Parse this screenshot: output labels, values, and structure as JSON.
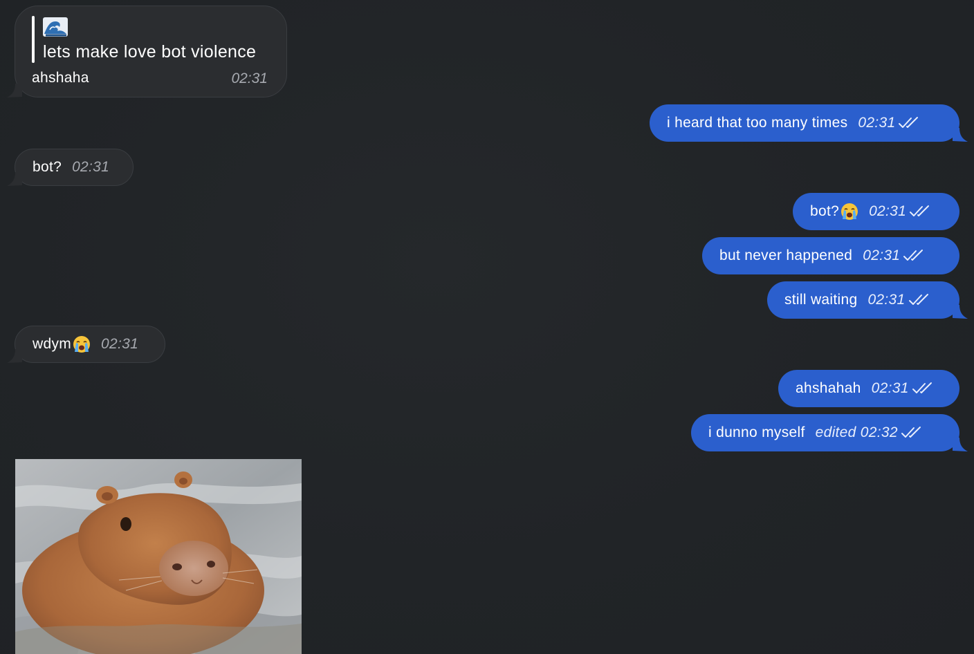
{
  "quote_message": {
    "emoji_icon": "water-wave-icon",
    "text": "lets make love bot violence",
    "sender": "ahshaha",
    "time": "02:31"
  },
  "messages": [
    {
      "text": "i heard that too many times",
      "time": "02:31"
    },
    {
      "text": "bot?",
      "time": "02:31"
    },
    {
      "text": "bot?",
      "time": "02:31",
      "emoji_icon": "loudly-crying-face-icon"
    },
    {
      "text": "but never happened",
      "time": "02:31"
    },
    {
      "text": "still waiting",
      "time": "02:31"
    },
    {
      "text": "wdym",
      "time": "02:31",
      "emoji_icon": "loudly-crying-face-icon"
    },
    {
      "text": "ahshahah",
      "time": "02:31"
    },
    {
      "text": "i dunno myself",
      "time": "edited 02:32"
    }
  ],
  "photo": {
    "subject": "capybara in water"
  },
  "colors": {
    "background": "#212427",
    "incoming_bubble": "#2b2d30",
    "outgoing_bubble": "#2b5fcd",
    "incoming_time": "#a7aab0"
  },
  "icons": {
    "read_receipt": "double-check-icon"
  }
}
